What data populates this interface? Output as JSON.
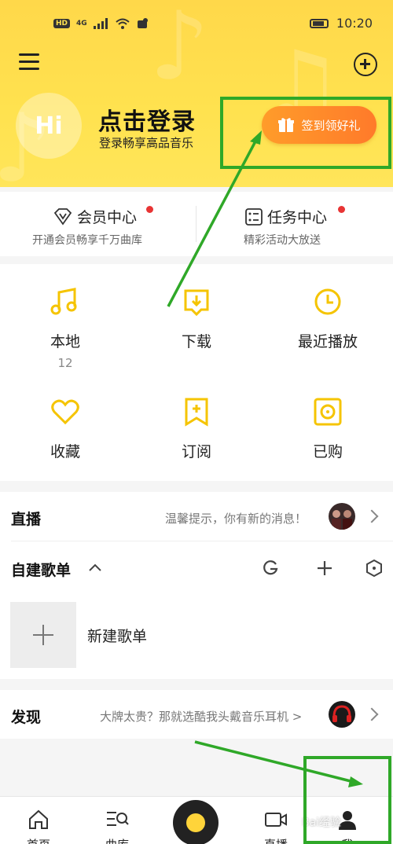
{
  "colors": {
    "accent": "#ffe24f",
    "brand_orange": "#ff8a2a",
    "annotation_green": "#2fa828",
    "notify_red": "#e83434"
  },
  "status_bar": {
    "time": "10:20",
    "hd": "HD",
    "network": "4G"
  },
  "header": {
    "menu_icon": "menu-icon",
    "add_icon": "plus-circle-icon",
    "avatar_text": "Hi",
    "login_title": "点击登录",
    "login_subtitle": "登录畅享高品音乐",
    "gift_button_label": "签到领好礼"
  },
  "member_cards": [
    {
      "icon": "vip-diamond-icon",
      "title": "会员中心",
      "subtitle": "开通会员畅享千万曲库"
    },
    {
      "icon": "task-list-icon",
      "title": "任务中心",
      "subtitle": "精彩活动大放送"
    }
  ],
  "grid": [
    {
      "icon": "music-note-icon",
      "label": "本地",
      "count": "12"
    },
    {
      "icon": "download-icon",
      "label": "下载",
      "count": ""
    },
    {
      "icon": "clock-icon",
      "label": "最近播放",
      "count": ""
    },
    {
      "icon": "heart-icon",
      "label": "收藏",
      "count": ""
    },
    {
      "icon": "subscribe-icon",
      "label": "订阅",
      "count": ""
    },
    {
      "icon": "purchased-icon",
      "label": "已购",
      "count": ""
    }
  ],
  "live": {
    "title": "直播",
    "hint": "温馨提示，你有新的消息！"
  },
  "playlists": {
    "title": "自建歌单",
    "new_label": "新建歌单"
  },
  "discover": {
    "title": "发现",
    "hint": "大牌太贵？那就选酷我头戴音乐耳机 >"
  },
  "tabs": [
    {
      "icon": "home-icon",
      "label": "首页"
    },
    {
      "icon": "library-icon",
      "label": "曲库"
    },
    {
      "icon": "live-camera-icon",
      "label": "直播"
    },
    {
      "icon": "user-icon",
      "label": "我"
    }
  ],
  "watermark": "Bai经验"
}
